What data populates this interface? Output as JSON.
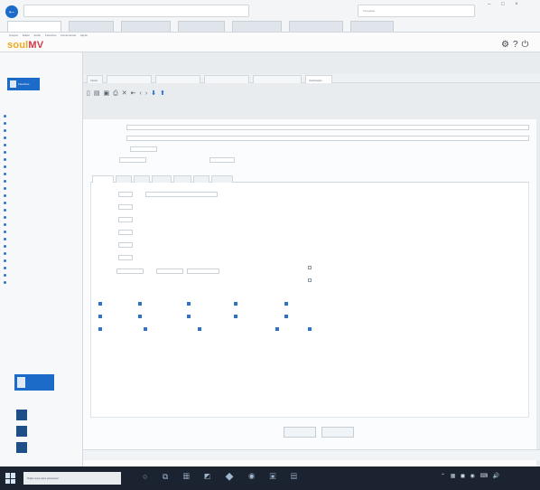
{
  "browser": {
    "url": "",
    "search_placeholder": "Pesquisar",
    "tabs": [
      "",
      "",
      "",
      "",
      "",
      "",
      ""
    ]
  },
  "app": {
    "logo_part1": "soul",
    "logo_part2": "MV",
    "menu": "Arquivo Editar Exibir Favoritos Ferramentas Ajuda",
    "module_label": "",
    "user_line1": "",
    "user_line2": ""
  },
  "doc_tabs": [
    "Inicial",
    "",
    "",
    "",
    "",
    "Solicitação"
  ],
  "sidebar": {
    "section_button": "Favoritos",
    "items": [
      "",
      "",
      "",
      "",
      "",
      "",
      "",
      "",
      "",
      "",
      "",
      "",
      "",
      "",
      "",
      "",
      "",
      "",
      "",
      "",
      "",
      "",
      "",
      ""
    ],
    "bottom_button": "",
    "bottom_title": "",
    "quick_buttons": [
      "",
      "",
      ""
    ]
  },
  "form": {
    "inner_tabs": [
      "",
      "",
      "",
      "",
      "",
      "",
      ""
    ],
    "ok_label": "",
    "cancel_label": ""
  },
  "taskbar": {
    "search_placeholder": "Digite aqui para pesquisar",
    "clock_time": "",
    "clock_date": ""
  },
  "colors": {
    "accent": "#1c6bc9",
    "logo_orange": "#f0a81c",
    "logo_red": "#d23a4b",
    "taskbar": "#1b2330"
  }
}
